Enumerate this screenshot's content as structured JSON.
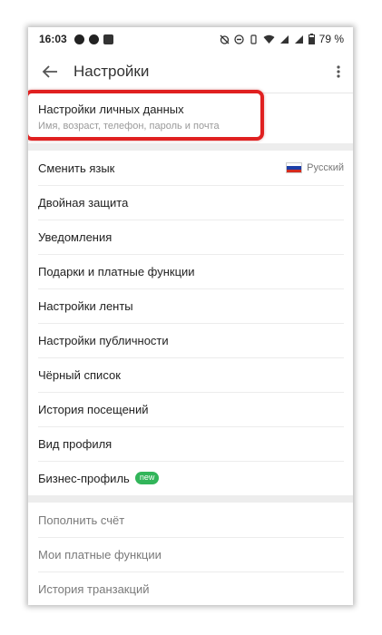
{
  "status_bar": {
    "time": "16:03",
    "battery": "79 %"
  },
  "toolbar": {
    "title": "Настройки"
  },
  "personal_data": {
    "title": "Настройки личных данных",
    "subtitle": "Имя, возраст, телефон, пароль и почта"
  },
  "language": {
    "label": "Сменить язык",
    "value": "Русский",
    "flag_colors": [
      "#ffffff",
      "#1c3fa8",
      "#d52b1e"
    ]
  },
  "settings_items": [
    "Двойная защита",
    "Уведомления",
    "Подарки и платные функции",
    "Настройки ленты",
    "Настройки публичности",
    "Чёрный список",
    "История посещений",
    "Вид профиля"
  ],
  "business_profile": {
    "label": "Бизнес-профиль",
    "badge": "new"
  },
  "payment_items": [
    "Пополнить счёт",
    "Мои платные функции",
    "История транзакций"
  ],
  "colors": {
    "highlight": "#e02020",
    "badge": "#32b55a"
  }
}
